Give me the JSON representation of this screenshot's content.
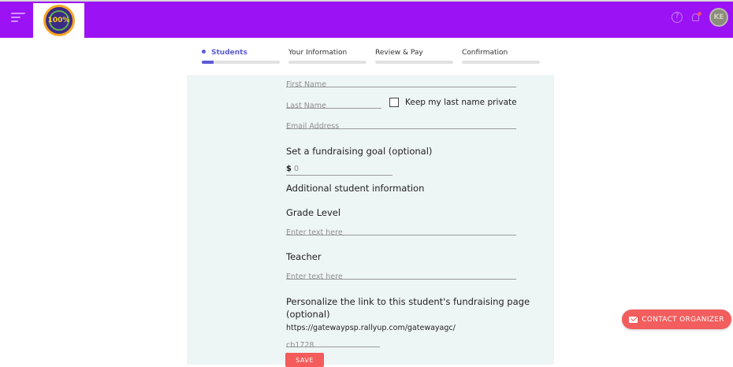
{
  "header": {
    "logo_text": "100%",
    "help_icon": "help-circle-icon",
    "notification_icon": "bell-icon",
    "avatar_initials": "KE",
    "brand_color": "#9b12f5"
  },
  "steps": [
    {
      "label": "Students",
      "active": true,
      "progress": 0.15
    },
    {
      "label": "Your Information",
      "active": false,
      "progress": 0
    },
    {
      "label": "Review & Pay",
      "active": false,
      "progress": 0
    },
    {
      "label": "Confirmation",
      "active": false,
      "progress": 0
    }
  ],
  "form": {
    "first_name_placeholder": "First Name",
    "last_name_placeholder": "Last Name",
    "keep_private_label": "Keep my last name private",
    "email_placeholder": "Email Address",
    "goal_title": "Set a fundraising goal (optional)",
    "goal_currency": "$",
    "goal_value": "0",
    "additional_title": "Additional student information",
    "grade_label": "Grade Level",
    "grade_placeholder": "Enter text here",
    "teacher_label": "Teacher",
    "teacher_placeholder": "Enter text here",
    "personalize_title_line1": "Personalize the link to this student's fundraising page",
    "personalize_title_line2": "(optional)",
    "url_base": "https://gatewaypsp.rallyup.com/gatewayagc/",
    "url_slug": "cb1728",
    "save_label": "SAVE"
  },
  "contact": {
    "label": "CONTACT ORGANIZER",
    "icon": "mail-icon",
    "color": "#f25d5d"
  }
}
